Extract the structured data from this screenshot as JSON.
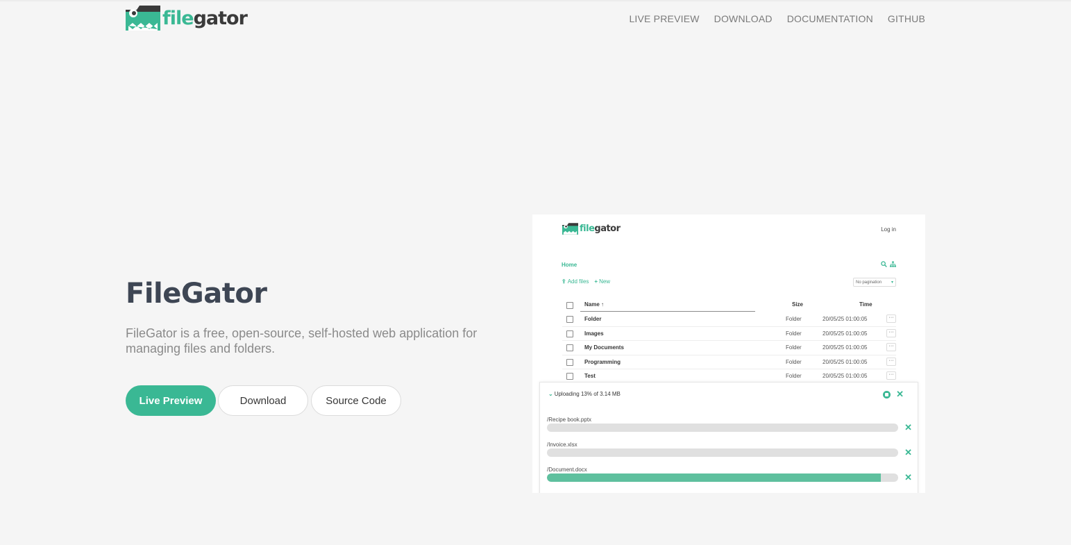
{
  "header": {
    "logo": {
      "part1": "file",
      "part2": "gator"
    },
    "nav": [
      "LIVE PREVIEW",
      "DOWNLOAD",
      "DOCUMENTATION",
      "GITHUB"
    ]
  },
  "hero": {
    "title": "FileGator",
    "description": "FileGator is a free, open-source, self-hosted web application for managing files and folders.",
    "buttons": {
      "live_preview": "Live Preview",
      "download": "Download",
      "source_code": "Source Code"
    }
  },
  "screenshot": {
    "logo": {
      "part1": "file",
      "part2": "gator"
    },
    "login": "Log in",
    "breadcrumb": "Home",
    "actions": {
      "add_files": "Add files",
      "new": "New"
    },
    "pagination": "No pagination",
    "columns": {
      "name": "Name",
      "size": "Size",
      "time": "Time"
    },
    "rows": [
      {
        "name": "Folder",
        "size": "Folder",
        "time": "20/05/25 01:00:05"
      },
      {
        "name": "Images",
        "size": "Folder",
        "time": "20/05/25 01:00:05"
      },
      {
        "name": "My Documents",
        "size": "Folder",
        "time": "20/05/25 01:00:05"
      },
      {
        "name": "Programming",
        "size": "Folder",
        "time": "20/05/25 01:00:05"
      },
      {
        "name": "Test",
        "size": "Folder",
        "time": "20/05/25 01:00:05"
      }
    ],
    "upload": {
      "status": "Uploading 13% of 3.14 MB",
      "files": [
        {
          "name": "/Recipe book.pptx",
          "progress": 0
        },
        {
          "name": "/Invoice.xlsx",
          "progress": 0
        },
        {
          "name": "/Document.docx",
          "progress": 95
        }
      ]
    }
  },
  "colors": {
    "accent": "#3ab894",
    "background": "#f5f5f5",
    "title": "#3e4654"
  },
  "icons": [
    "filegator-logo-icon",
    "search-icon",
    "sitemap-icon",
    "upload-icon",
    "plus-icon",
    "pause-icon",
    "close-icon",
    "chevron-down-icon",
    "more-icon"
  ]
}
